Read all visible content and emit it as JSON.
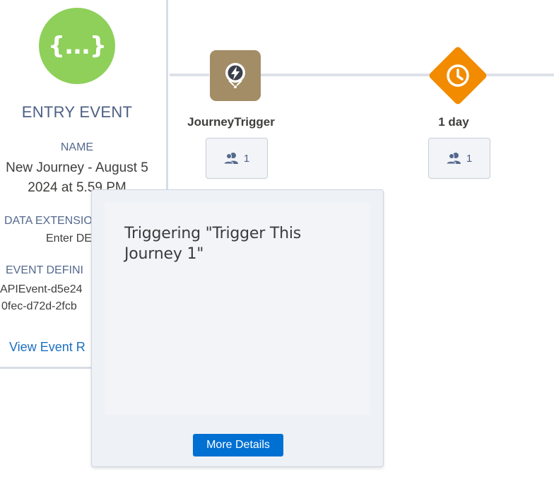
{
  "entry": {
    "icon_glyph": "{...}",
    "title": "ENTRY EVENT",
    "name_label": "NAME",
    "name_line1": "New Journey - August 5",
    "name_line2": "2024 at 5.59 PM",
    "data_extension_label": "DATA EXTENSIO",
    "data_extension_value": "Enter DE",
    "event_definition_label": "EVENT DEFINI",
    "event_definition_line1": "APIEvent-d5e24",
    "event_definition_line2": "0fec-d72d-2fcb",
    "view_link": "View Event R"
  },
  "canvas": {
    "trigger_node": {
      "label": "JourneyTrigger",
      "count": "1",
      "icon": "lightning-bolt-icon",
      "color": "#a38d67"
    },
    "wait_node": {
      "label": "1 day",
      "count": "1",
      "icon": "clock-icon",
      "color": "#f28b00"
    }
  },
  "popover": {
    "text": "Triggering \"Trigger This Journey 1\"",
    "button_label": "More Details"
  },
  "colors": {
    "entry_icon": "#8ed05a",
    "link": "#1c6fc1",
    "primary_button": "#0070d2"
  }
}
